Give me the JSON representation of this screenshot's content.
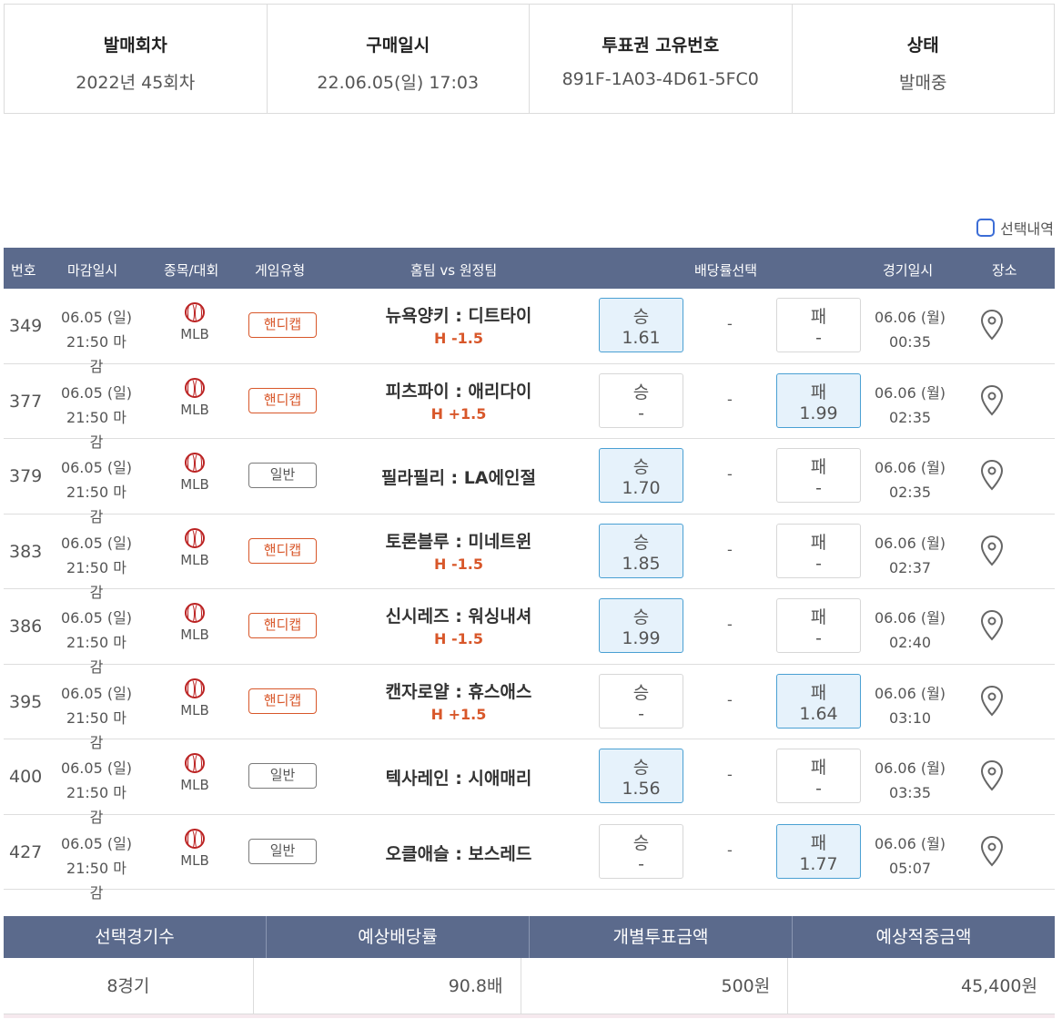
{
  "info": {
    "round_label": "발매회차",
    "round_value": "2022년 45회차",
    "purchase_label": "구매일시",
    "purchase_value": "22.06.05(일) 17:03",
    "ticket_label": "투표권 고유번호",
    "ticket_value": "891F-1A03-4D61-5FC0",
    "status_label": "상태",
    "status_value": "발매중"
  },
  "toggle_label": "선택내역",
  "headers": {
    "no": "번호",
    "deadline": "마감일시",
    "sport": "종목/대회",
    "type": "게임유형",
    "teams": "홈팀 vs 원정팀",
    "odds": "배당률선택",
    "date": "경기일시",
    "venue": "장소"
  },
  "rows": [
    {
      "no": "349",
      "d1": "06.05 (일)",
      "d2": "21:50 마감",
      "league": "MLB",
      "type": "핸디캡",
      "teams": "뉴욕양키 : 디트타이",
      "hc": "H -1.5",
      "win_t": "승",
      "win_v": "1.61",
      "draw": "-",
      "lose_t": "패",
      "lose_v": "-",
      "g1": "06.06 (월)",
      "g2": "00:35"
    },
    {
      "no": "377",
      "d1": "06.05 (일)",
      "d2": "21:50 마감",
      "league": "MLB",
      "type": "핸디캡",
      "teams": "피츠파이 : 애리다이",
      "hc": "H +1.5",
      "win_t": "승",
      "win_v": "-",
      "draw": "-",
      "lose_t": "패",
      "lose_v": "1.99",
      "g1": "06.06 (월)",
      "g2": "02:35"
    },
    {
      "no": "379",
      "d1": "06.05 (일)",
      "d2": "21:50 마감",
      "league": "MLB",
      "type": "일반",
      "teams": "필라필리 : LA에인절",
      "hc": "",
      "win_t": "승",
      "win_v": "1.70",
      "draw": "-",
      "lose_t": "패",
      "lose_v": "-",
      "g1": "06.06 (월)",
      "g2": "02:35"
    },
    {
      "no": "383",
      "d1": "06.05 (일)",
      "d2": "21:50 마감",
      "league": "MLB",
      "type": "핸디캡",
      "teams": "토론블루 : 미네트윈",
      "hc": "H -1.5",
      "win_t": "승",
      "win_v": "1.85",
      "draw": "-",
      "lose_t": "패",
      "lose_v": "-",
      "g1": "06.06 (월)",
      "g2": "02:37"
    },
    {
      "no": "386",
      "d1": "06.05 (일)",
      "d2": "21:50 마감",
      "league": "MLB",
      "type": "핸디캡",
      "teams": "신시레즈 : 워싱내셔",
      "hc": "H -1.5",
      "win_t": "승",
      "win_v": "1.99",
      "draw": "-",
      "lose_t": "패",
      "lose_v": "-",
      "g1": "06.06 (월)",
      "g2": "02:40"
    },
    {
      "no": "395",
      "d1": "06.05 (일)",
      "d2": "21:50 마감",
      "league": "MLB",
      "type": "핸디캡",
      "teams": "캔자로얄 : 휴스애스",
      "hc": "H +1.5",
      "win_t": "승",
      "win_v": "-",
      "draw": "-",
      "lose_t": "패",
      "lose_v": "1.64",
      "g1": "06.06 (월)",
      "g2": "03:10"
    },
    {
      "no": "400",
      "d1": "06.05 (일)",
      "d2": "21:50 마감",
      "league": "MLB",
      "type": "일반",
      "teams": "텍사레인 : 시애매리",
      "hc": "",
      "win_t": "승",
      "win_v": "1.56",
      "draw": "-",
      "lose_t": "패",
      "lose_v": "-",
      "g1": "06.06 (월)",
      "g2": "03:35"
    },
    {
      "no": "427",
      "d1": "06.05 (일)",
      "d2": "21:50 마감",
      "league": "MLB",
      "type": "일반",
      "teams": "오클애슬 : 보스레드",
      "hc": "",
      "win_t": "승",
      "win_v": "-",
      "draw": "-",
      "lose_t": "패",
      "lose_v": "1.77",
      "g1": "06.06 (월)",
      "g2": "05:07"
    }
  ],
  "summary": {
    "count_label": "선택경기수",
    "count_value": "8경기",
    "odds_label": "예상배당률",
    "odds_value": "90.8배",
    "bet_label": "개별투표금액",
    "bet_value": "500원",
    "win_label": "예상적중금액",
    "win_value": "45,400원"
  }
}
